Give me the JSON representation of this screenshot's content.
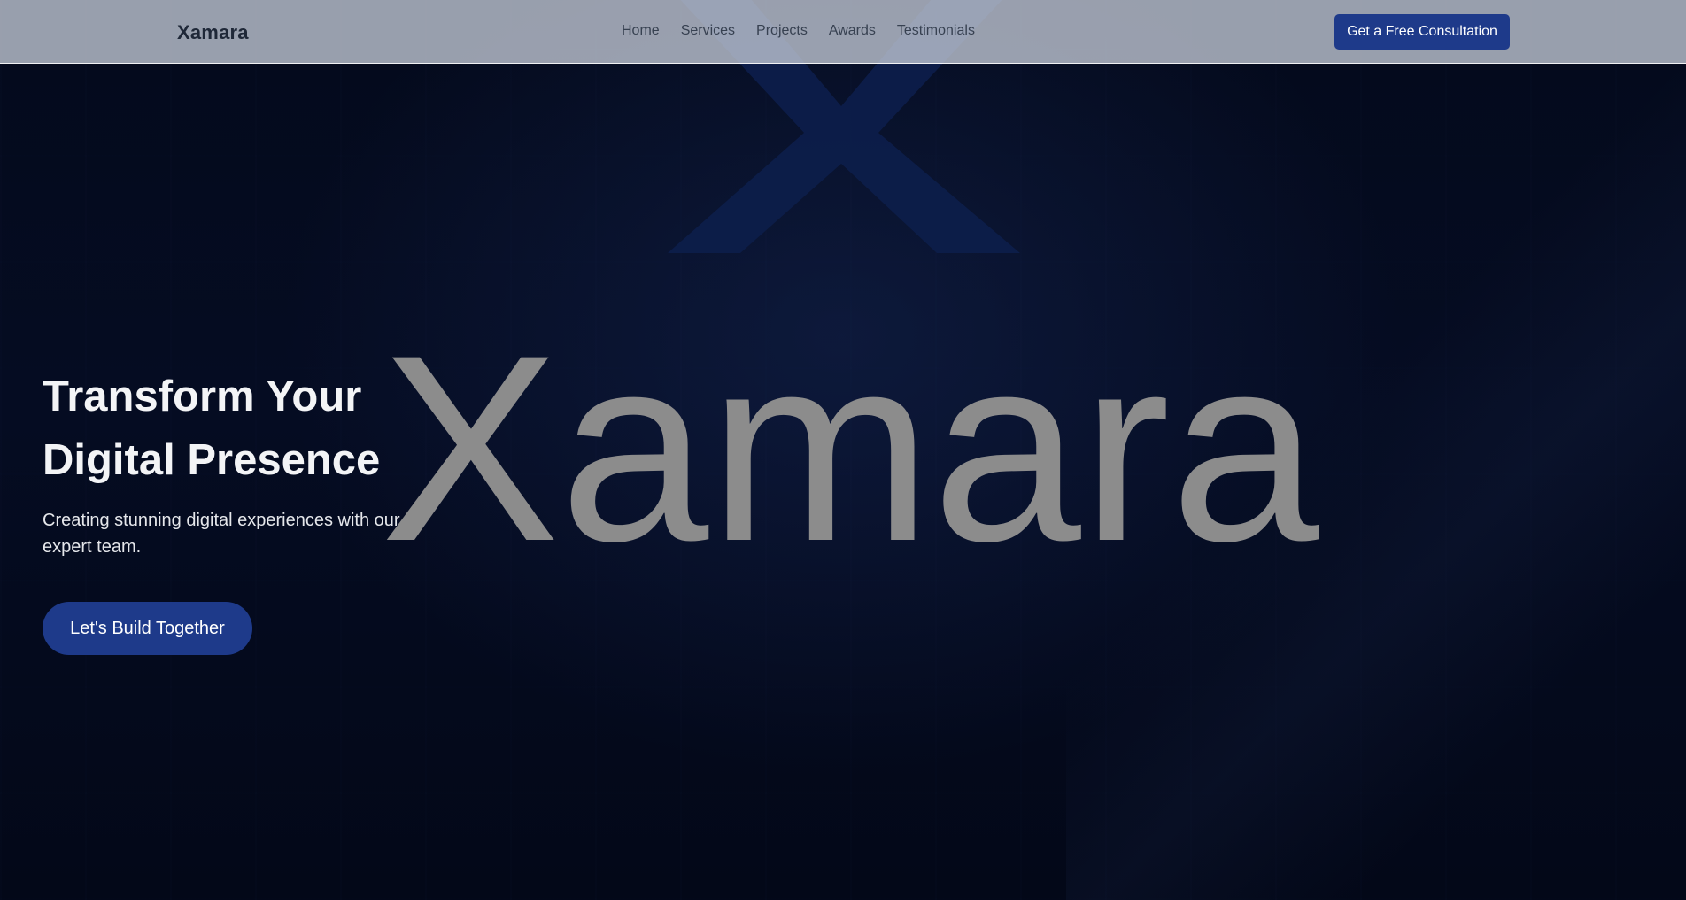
{
  "nav": {
    "brand": "Xamara",
    "links": [
      "Home",
      "Services",
      "Projects",
      "Awards",
      "Testimonials"
    ],
    "cta_label": "Get a Free Consultation"
  },
  "hero": {
    "title_line1": "Transform Your",
    "title_line2": "Digital Presence",
    "subtitle": "Creating stunning digital experiences with our expert team.",
    "cta_label": "Let's Build Together",
    "background_logo_text": "Xamara"
  },
  "colors": {
    "accent": "#1e3a8a",
    "hero_bg": "#030818",
    "navbar_bg": "#c3c9d6",
    "logo_x": "#0d1d4a",
    "logo_word": "#8c8c8c"
  },
  "icons": {
    "logo_mark": "x-logo-icon"
  }
}
